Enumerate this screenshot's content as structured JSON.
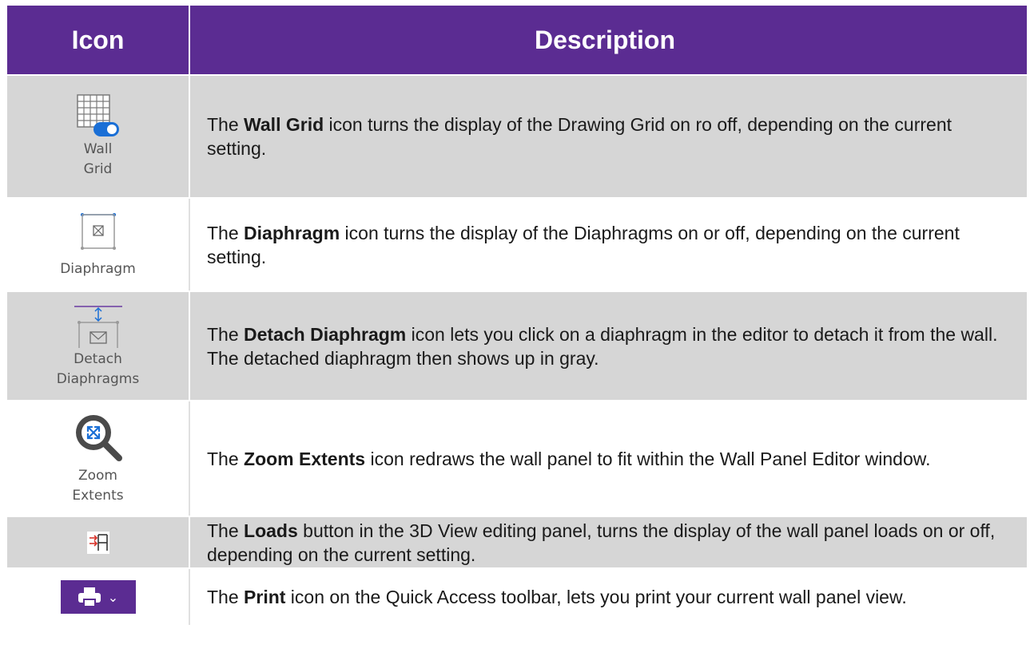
{
  "header": {
    "icon": "Icon",
    "description": "Description"
  },
  "rows": [
    {
      "icon_name": "wall-grid-icon",
      "icon_label_lines": [
        "Wall",
        "Grid"
      ],
      "bold": "Wall Grid",
      "pre": "The ",
      "post": " icon turns the display of the Drawing Grid on ro off, depending on the current setting."
    },
    {
      "icon_name": "diaphragm-icon",
      "icon_label_lines": [
        "Diaphragm"
      ],
      "bold": "Diaphragm",
      "pre": "The ",
      "post": " icon turns the display of the Diaphragms on or off, depending on the current setting."
    },
    {
      "icon_name": "detach-diaphragm-icon",
      "icon_label_lines": [
        "Detach",
        "Diaphragms"
      ],
      "bold": "Detach Diaphragm",
      "pre": "The ",
      "post": " icon lets you click on a diaphragm in the editor to detach it from the wall. The detached diaphragm then shows up in gray."
    },
    {
      "icon_name": "zoom-extents-icon",
      "icon_label_lines": [
        "Zoom",
        "Extents"
      ],
      "bold": "Zoom Extents",
      "pre": "The  ",
      "post": " icon redraws the wall panel to fit within the Wall Panel Editor window."
    },
    {
      "icon_name": "loads-icon",
      "icon_label_lines": [],
      "bold": "Loads",
      "pre": "The ",
      "post": " button in the 3D View editing panel, turns the display of the wall panel loads on or off, depending on the current setting."
    },
    {
      "icon_name": "print-icon",
      "icon_label_lines": [],
      "bold": "Print",
      "pre": "The ",
      "post": " icon on the Quick Access toolbar, lets you print your current wall panel view."
    }
  ],
  "colors": {
    "header_bg": "#5b2c92",
    "row_shade": "#d6d6d6",
    "toggle_blue": "#1a6fd6"
  }
}
